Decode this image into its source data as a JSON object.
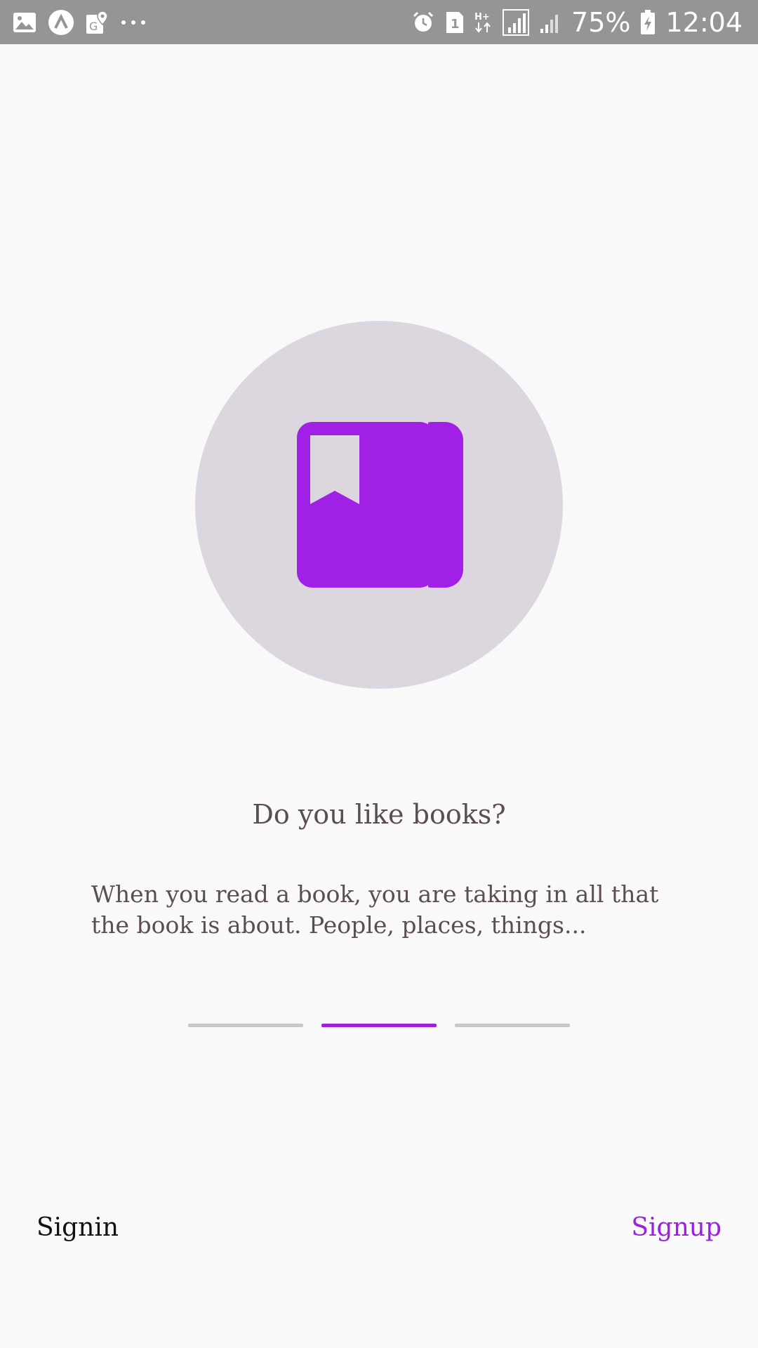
{
  "status_bar": {
    "left_icons": [
      "gallery-icon",
      "app-a-icon",
      "maps-icon",
      "more-dots-icon"
    ],
    "right_icons": [
      "alarm-icon",
      "sim-1-icon",
      "hplus-data-icon",
      "signal-icon",
      "signal-icon-2",
      "battery-charging-icon"
    ],
    "battery": "75%",
    "time": "12:04"
  },
  "onboarding": {
    "illustration_icon": "book-bookmark-icon",
    "title": "Do you like books?",
    "description": "When you read a book, you are taking in all that the book is about. People, places, things...",
    "pages": 3,
    "active_page": 2
  },
  "actions": {
    "signin_label": "Signin",
    "signup_label": "Signup"
  },
  "colors": {
    "accent": "#9b21de",
    "book": "#a020e6",
    "circle": "#dcd7de",
    "indicator_inactive": "#c8c8c8",
    "text": "#5b4e4e",
    "status_bar": "#959595",
    "background": "#f9f9fa"
  }
}
